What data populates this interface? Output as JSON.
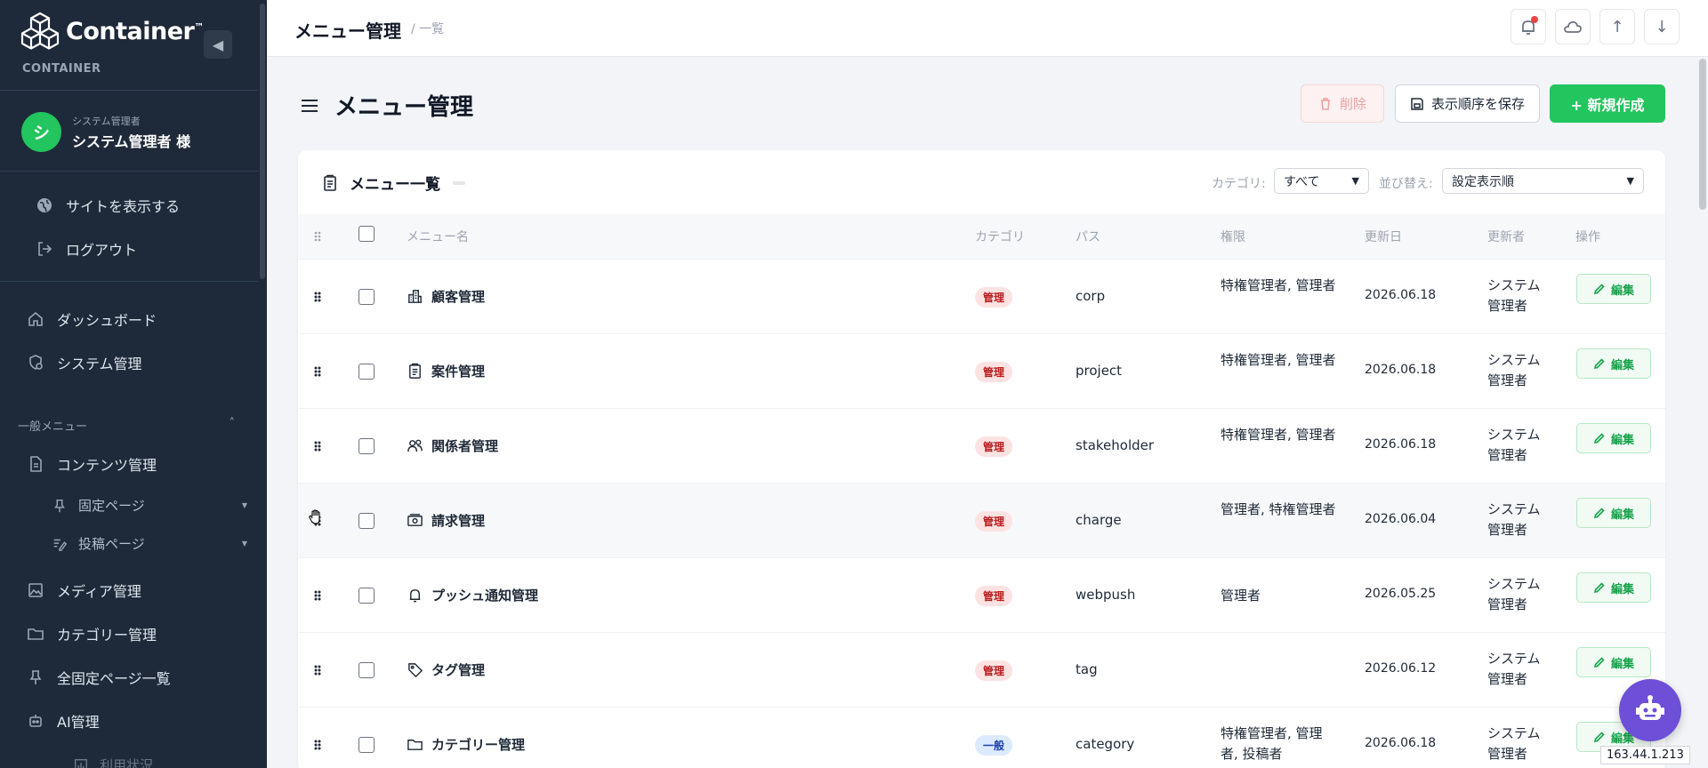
{
  "sidebar": {
    "brand": "Container",
    "brand_tm": "™",
    "brand_sub": "CONTAINER",
    "collapse_icon": "◀",
    "user": {
      "initial": "シ",
      "role": "システム管理者",
      "name": "システム管理者 様"
    },
    "site_link": "サイトを表示する",
    "logout": "ログアウト",
    "items": [
      {
        "label": "ダッシュボード",
        "icon": "home-icon"
      },
      {
        "label": "システム管理",
        "icon": "gear-shield-icon"
      }
    ],
    "section_label": "一般メニュー",
    "section_caret": "˄",
    "content": {
      "label": "コンテンツ管理",
      "icon": "document-icon"
    },
    "sub_items": [
      {
        "label": "固定ページ",
        "icon": "pin-icon",
        "caret": "▼"
      },
      {
        "label": "投稿ページ",
        "icon": "edit-list-icon",
        "caret": "▼"
      }
    ],
    "more_items": [
      {
        "label": "メディア管理",
        "icon": "image-icon"
      },
      {
        "label": "カテゴリー管理",
        "icon": "folder-icon"
      },
      {
        "label": "全固定ページ一覧",
        "icon": "pin-icon"
      },
      {
        "label": "AI管理",
        "icon": "robot-icon"
      }
    ],
    "partial_item": "利用状況"
  },
  "topbar": {
    "title": "メニュー管理",
    "crumb": "/ 一覧",
    "buttons": [
      "bell-icon",
      "cloud-icon",
      "↑",
      "↓"
    ]
  },
  "page": {
    "title": "メニュー管理",
    "delete_label": "削除",
    "save_order_label": "表示順序を保存",
    "new_label": "+ 新規作成"
  },
  "card": {
    "title": "メニュー一覧",
    "category_label": "カテゴリ:",
    "category_value": "すべて",
    "sort_label": "並び替え:",
    "sort_value": "設定表示順"
  },
  "table": {
    "headers": {
      "name": "メニュー名",
      "category": "カテゴリ",
      "path": "パス",
      "permission": "権限",
      "updated": "更新日",
      "updater": "更新者",
      "action": "操作"
    },
    "edit_label": "編集",
    "rows": [
      {
        "icon": "building-icon",
        "name": "顧客管理",
        "category": "管理",
        "category_type": "admin",
        "path": "corp",
        "permission": "特権管理者, 管理者",
        "updated": "2026.06.18",
        "updater": "システム管理者"
      },
      {
        "icon": "clipboard-icon",
        "name": "案件管理",
        "category": "管理",
        "category_type": "admin",
        "path": "project",
        "permission": "特権管理者, 管理者",
        "updated": "2026.06.18",
        "updater": "システム管理者"
      },
      {
        "icon": "users-icon",
        "name": "関係者管理",
        "category": "管理",
        "category_type": "admin",
        "path": "stakeholder",
        "permission": "特権管理者, 管理者",
        "updated": "2026.06.18",
        "updater": "システム管理者"
      },
      {
        "icon": "money-icon",
        "name": "請求管理",
        "category": "管理",
        "category_type": "admin",
        "path": "charge",
        "permission": "管理者, 特権管理者",
        "updated": "2026.06.04",
        "updater": "システム管理者"
      },
      {
        "icon": "bell-icon",
        "name": "プッシュ通知管理",
        "category": "管理",
        "category_type": "admin",
        "path": "webpush",
        "permission": "管理者",
        "updated": "2026.05.25",
        "updater": "システム管理者"
      },
      {
        "icon": "tag-icon",
        "name": "タグ管理",
        "category": "管理",
        "category_type": "admin",
        "path": "tag",
        "permission": "",
        "updated": "2026.06.12",
        "updater": "システム管理者"
      },
      {
        "icon": "folder-icon",
        "name": "カテゴリー管理",
        "category": "一般",
        "category_type": "general",
        "path": "category",
        "permission": "特権管理者, 管理者, 投稿者",
        "updated": "2026.06.18",
        "updater": "システム管理者"
      }
    ]
  },
  "footer": {
    "ip": "163.44.1.213"
  },
  "colors": {
    "sidebar_bg": "#1e2a3a",
    "accent_green": "#22c55e",
    "robot_purple": "#6d4fd8",
    "admin_badge": "#fde2e2",
    "general_badge": "#dbeafe"
  }
}
